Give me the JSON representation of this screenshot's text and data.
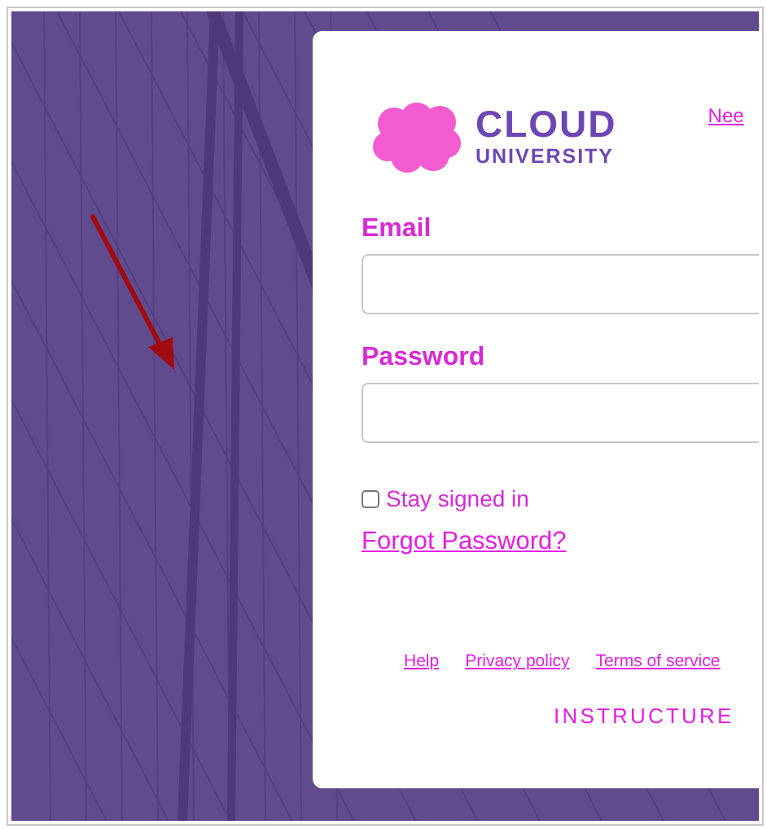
{
  "header": {
    "logo": {
      "line1": "CLOUD",
      "line2": "UNIVERSITY"
    },
    "link": "Nee"
  },
  "form": {
    "fields": [
      {
        "label": "Email"
      },
      {
        "label": "Password"
      }
    ],
    "remember": {
      "label": "Stay signed in",
      "checked": false
    },
    "forgot_link": "Forgot Password?"
  },
  "footer": {
    "links": [
      "Help",
      "Privacy policy",
      "Terms of service"
    ],
    "brand": "INSTRUCTURE"
  }
}
